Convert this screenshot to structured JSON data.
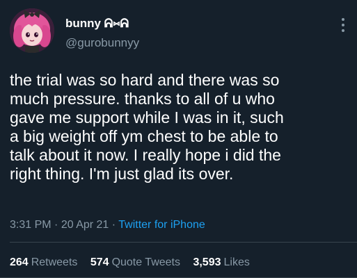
{
  "author": {
    "display_name": "bunny ᕱ⑅ᕱ",
    "handle": "@gurobunnyy"
  },
  "tweet": {
    "text": "the trial was so hard and there was so\nmuch pressure. thanks to all of u who\ngave me support while I was in it, such\na big weight off ym chest to be able to\ntalk about it now. I really hope i did the\nright thing. I'm just glad its over.",
    "time": "3:31 PM",
    "sep1": "·",
    "date": "20 Apr 21",
    "sep2": "·",
    "source": "Twitter for iPhone"
  },
  "stats": {
    "retweets_count": "264",
    "retweets_label": "Retweets",
    "quotes_count": "574",
    "quotes_label": "Quote Tweets",
    "likes_count": "3,593",
    "likes_label": "Likes"
  },
  "icons": {
    "more": "more-vertical-icon",
    "avatar": "avatar-image"
  },
  "colors": {
    "background": "#15202b",
    "text": "#ffffff",
    "secondary": "#8899a6",
    "link": "#1da1f2"
  }
}
